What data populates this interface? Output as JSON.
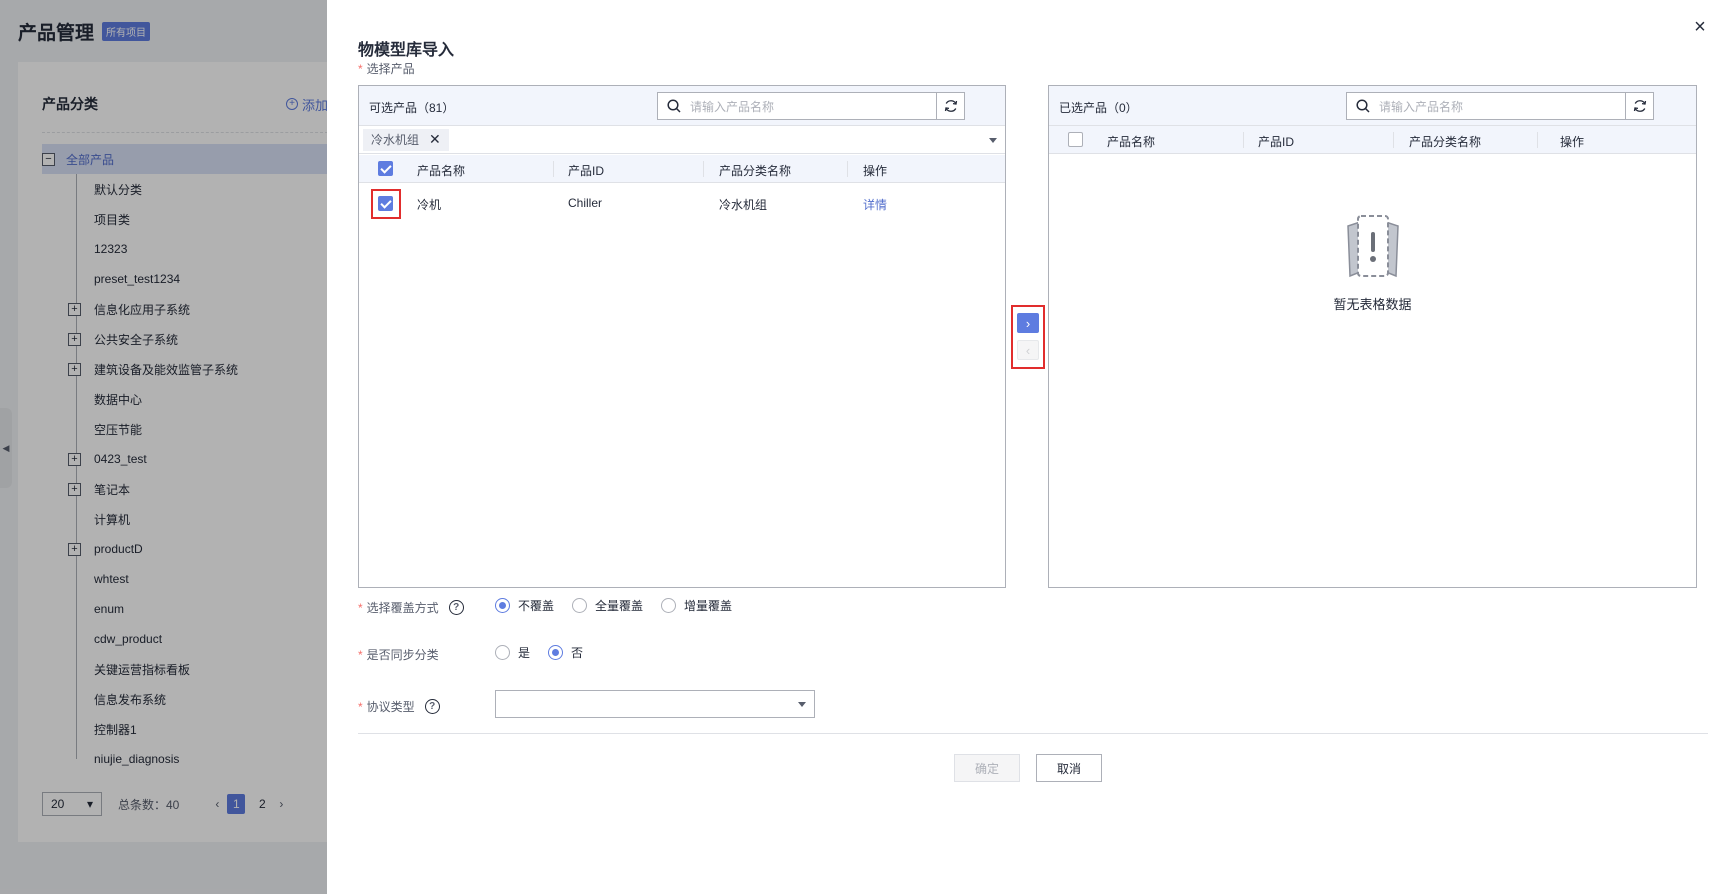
{
  "background": {
    "title": "产品管理",
    "tag": "所有项目",
    "card_title": "产品分类",
    "add_label": "添加",
    "tree": [
      {
        "label": "全部产品",
        "toggle": "−",
        "selected": true,
        "level": 0
      },
      {
        "label": "默认分类",
        "toggle": "",
        "level": 1
      },
      {
        "label": "项目类",
        "toggle": "",
        "level": 1
      },
      {
        "label": "12323",
        "toggle": "",
        "level": 1
      },
      {
        "label": "preset_test1234",
        "toggle": "",
        "level": 1
      },
      {
        "label": "信息化应用子系统",
        "toggle": "+",
        "level": 1
      },
      {
        "label": "公共安全子系统",
        "toggle": "+",
        "level": 1
      },
      {
        "label": "建筑设备及能效监管子系统",
        "toggle": "+",
        "level": 1
      },
      {
        "label": "数据中心",
        "toggle": "",
        "level": 1
      },
      {
        "label": "空压节能",
        "toggle": "",
        "level": 1
      },
      {
        "label": "0423_test",
        "toggle": "+",
        "level": 1
      },
      {
        "label": "笔记本",
        "toggle": "+",
        "level": 1
      },
      {
        "label": "计算机",
        "toggle": "",
        "level": 1
      },
      {
        "label": "productD",
        "toggle": "+",
        "level": 1
      },
      {
        "label": "whtest",
        "toggle": "",
        "level": 1
      },
      {
        "label": "enum",
        "toggle": "",
        "level": 1
      },
      {
        "label": "cdw_product",
        "toggle": "",
        "level": 1
      },
      {
        "label": "关键运营指标看板",
        "toggle": "",
        "level": 1
      },
      {
        "label": "信息发布系统",
        "toggle": "",
        "level": 1
      },
      {
        "label": "控制器1",
        "toggle": "",
        "level": 1
      },
      {
        "label": "niujie_diagnosis",
        "toggle": "",
        "level": 1
      }
    ],
    "pager": {
      "size": "20",
      "total": "总条数：40",
      "pages": [
        "1",
        "2"
      ],
      "current": "1"
    }
  },
  "drawer": {
    "title": "物模型库导入",
    "select_product_label": "选择产品",
    "required_mark": "*",
    "left": {
      "header": "可选产品（81）",
      "search_placeholder": "请输入产品名称",
      "filter_chip": "冷水机组",
      "columns": [
        "产品名称",
        "产品ID",
        "产品分类名称",
        "操作"
      ],
      "rows": [
        {
          "name": "冷机",
          "id": "Chiller",
          "category": "冷水机组",
          "action": "详情",
          "checked": true
        }
      ]
    },
    "right": {
      "header": "已选产品（0）",
      "search_placeholder": "请输入产品名称",
      "columns": [
        "产品名称",
        "产品ID",
        "产品分类名称",
        "操作"
      ],
      "empty_text": "暂无表格数据"
    },
    "transfer": {
      "to_right": "›",
      "to_left": "‹"
    },
    "cover_mode": {
      "label": "选择覆盖方式",
      "options": [
        "不覆盖",
        "全量覆盖",
        "增量覆盖"
      ],
      "selected": "不覆盖"
    },
    "sync_category": {
      "label": "是否同步分类",
      "options": [
        "是",
        "否"
      ],
      "selected": "否"
    },
    "protocol": {
      "label": "协议类型",
      "value": ""
    },
    "confirm_label": "确定",
    "cancel_label": "取消",
    "close_icon": "×"
  },
  "colors": {
    "accent": "#5e7ce0",
    "highlight_box": "#e12d2d",
    "required": "#f66f6a"
  }
}
